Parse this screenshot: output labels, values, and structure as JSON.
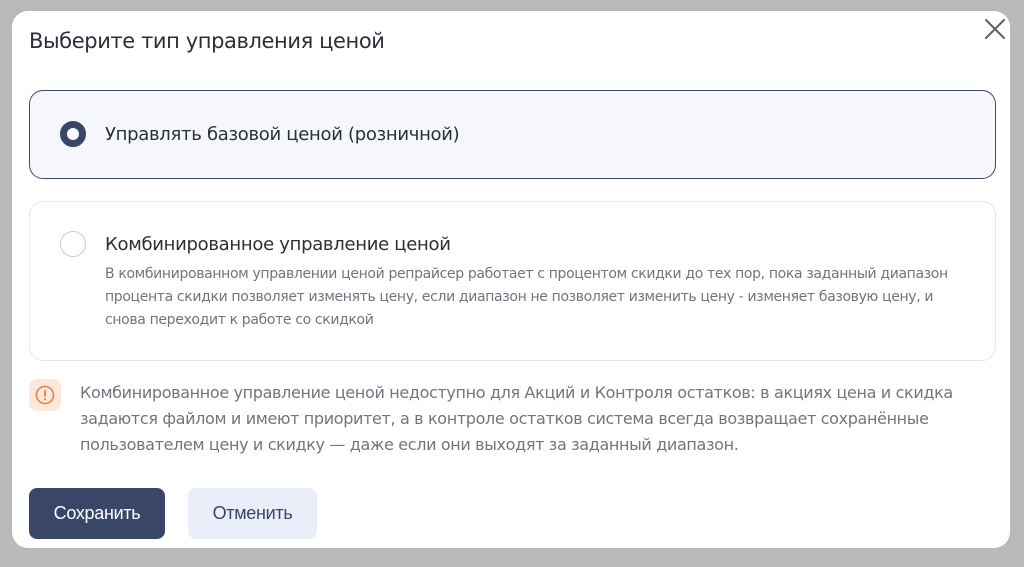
{
  "dialog": {
    "title": "Выберите тип управления ценой",
    "close_icon": "close-icon"
  },
  "options": [
    {
      "label": "Управлять базовой ценой (розничной)",
      "selected": true
    },
    {
      "label": "Комбинированное управление ценой",
      "description": "В комбинированном управлении ценой репрайсер работает с процентом скидки до тех пор, пока заданный диапазон процента скидки позволяет изменять цену, если диапазон не позволяет изменить цену - изменяет базовую цену, и снова переходит к работе со скидкой",
      "selected": false
    }
  ],
  "notice": {
    "icon": "alert-circle-icon",
    "text": "Комбинированное управление ценой недоступно для Акций и Контроля остатков: в акциях цена и скидка задаются файлом и имеют приоритет, а в контроле остатков система всегда возвращает сохранённые пользователем цену и скидку — даже если они выходят за заданный диапазон."
  },
  "buttons": {
    "save_label": "Сохранить",
    "cancel_label": "Отменить"
  },
  "colors": {
    "primary": "#3a4668",
    "selected_bg": "#f5f7fa",
    "notice_icon": "#e8843f",
    "notice_icon_bg": "#fde9dc",
    "cancel_bg": "#e9eef9",
    "backdrop": "#b9b9bc"
  }
}
